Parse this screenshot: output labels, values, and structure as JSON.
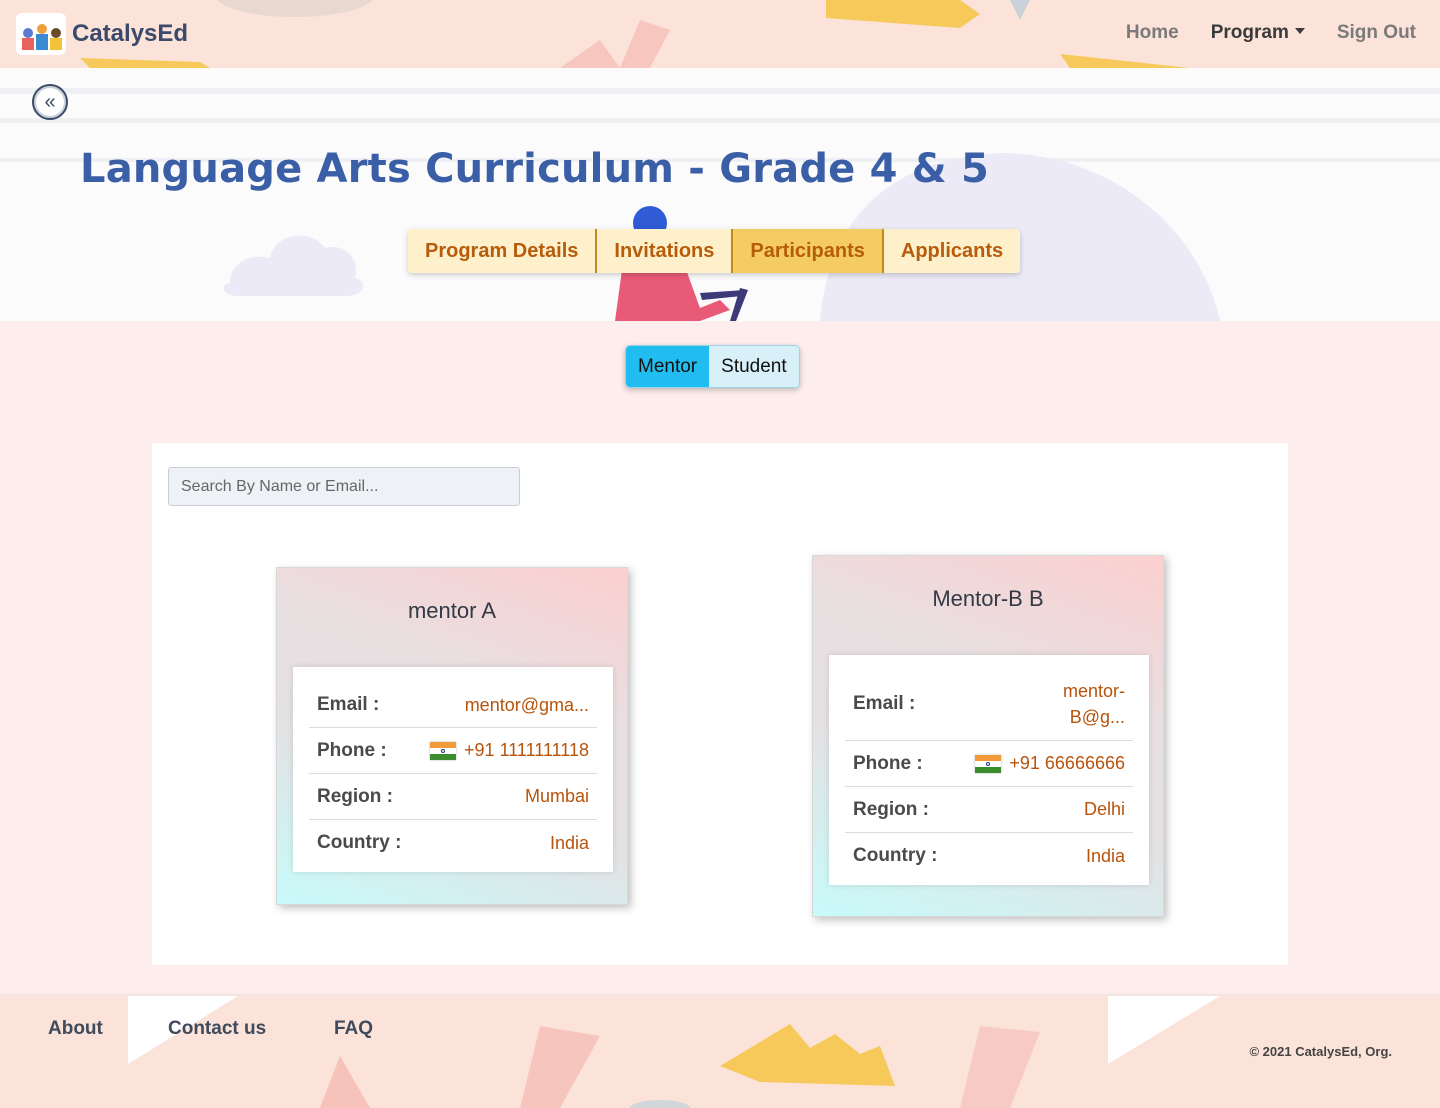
{
  "nav": {
    "brand": "CatalysEd",
    "links": [
      {
        "label": "Home"
      },
      {
        "label": "Program"
      },
      {
        "label": "Sign Out"
      }
    ]
  },
  "hero": {
    "back_icon": "«",
    "title": "Language Arts Curriculum - Grade 4 & 5",
    "tabs": [
      {
        "label": "Program Details",
        "active": false
      },
      {
        "label": "Invitations",
        "active": false
      },
      {
        "label": "Participants",
        "active": true
      },
      {
        "label": "Applicants",
        "active": false
      }
    ]
  },
  "toggle": {
    "options": [
      {
        "label": "Mentor",
        "active": true
      },
      {
        "label": "Student",
        "active": false
      }
    ]
  },
  "search": {
    "placeholder": "Search By Name or Email..."
  },
  "cards": [
    {
      "name": "mentor A",
      "email_label": "Email :",
      "email": "mentor@gma...",
      "phone_label": "Phone :",
      "phone": "+91 1111111118",
      "region_label": "Region :",
      "region": "Mumbai",
      "country_label": "Country :",
      "country": "India"
    },
    {
      "name": "Mentor-B B",
      "email_label": "Email :",
      "email_line1": "mentor-",
      "email_line2": "B@g...",
      "phone_label": "Phone :",
      "phone": "+91 66666666",
      "region_label": "Region :",
      "region": "Delhi",
      "country_label": "Country :",
      "country": "India"
    }
  ],
  "footer": {
    "links": [
      {
        "label": "About"
      },
      {
        "label": "Contact us"
      },
      {
        "label": "FAQ"
      }
    ],
    "copyright": "© 2021 CatalysEd, Org."
  },
  "colors": {
    "accent_blue": "#3a5fa6",
    "tab_text": "#b75c0a",
    "tab_active": "#f4cc63",
    "toggle_active": "#22bdf0"
  }
}
